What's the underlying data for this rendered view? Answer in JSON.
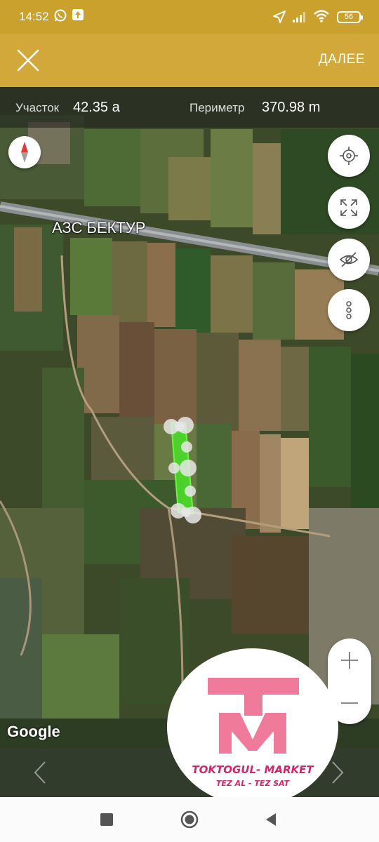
{
  "status_bar": {
    "time": "14:52",
    "battery": "56",
    "icons": [
      "whatsapp-icon",
      "notification-icon",
      "location-arrow-icon",
      "signal-icon",
      "wifi-icon",
      "battery-icon"
    ]
  },
  "app_bar": {
    "close_icon": "close-icon",
    "next_label": "ДАЛЕЕ",
    "background": "#d2a83a"
  },
  "info": {
    "area_label": "Участок",
    "area_value": "42.35 a",
    "perimeter_label": "Периметр",
    "perimeter_value": "370.98 m"
  },
  "map": {
    "poi_label": "АЗС БЕКТУР",
    "provider": "Google",
    "polygon_color": "#4cd62a",
    "controls": [
      "crosshair-icon",
      "fullscreen-icon",
      "visibility-off-icon",
      "more-vert-icon"
    ],
    "zoom_in": "+",
    "zoom_out": "−"
  },
  "watermark": {
    "line1": "TOKTOGUL- MARKET",
    "line2": "TEZ AL - TEZ SAT",
    "color": "#f07a9a"
  },
  "nav_bar": {
    "buttons": [
      "recents-icon",
      "home-icon",
      "back-icon"
    ]
  }
}
